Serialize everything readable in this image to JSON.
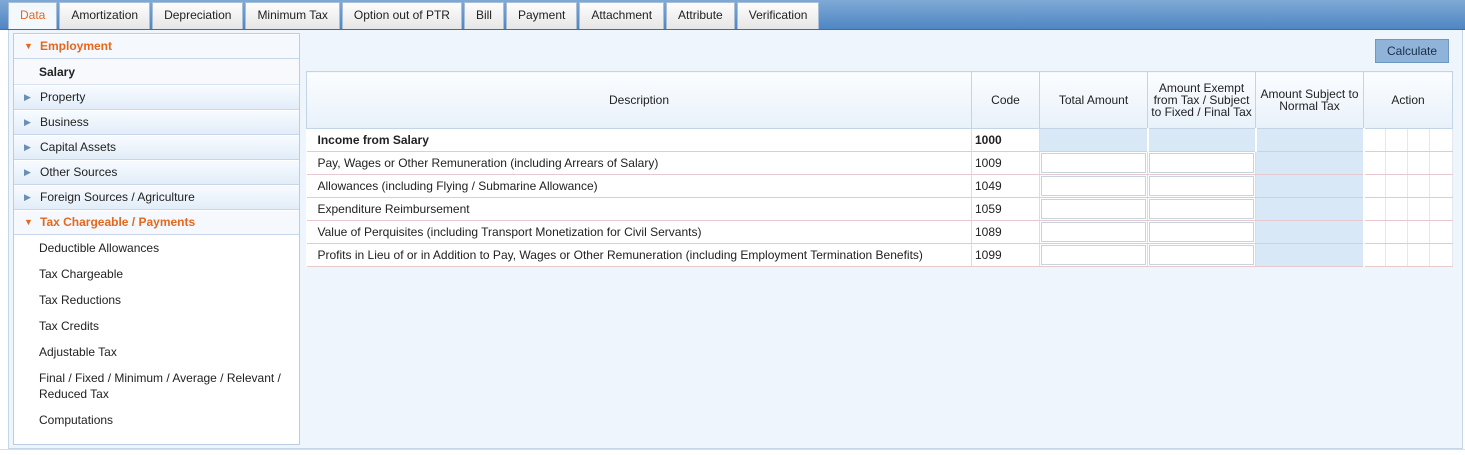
{
  "tabs": [
    "Data",
    "Amortization",
    "Depreciation",
    "Minimum Tax",
    "Option out of PTR",
    "Bill",
    "Payment",
    "Attachment",
    "Attribute",
    "Verification"
  ],
  "sidebar": {
    "employment": "Employment",
    "salary": "Salary",
    "property": "Property",
    "business": "Business",
    "capital_assets": "Capital Assets",
    "other_sources": "Other Sources",
    "foreign_sources": "Foreign Sources / Agriculture",
    "tax_chargeable": "Tax Chargeable / Payments",
    "sub_items": [
      "Deductible Allowances",
      "Tax Chargeable",
      "Tax Reductions",
      "Tax Credits",
      "Adjustable Tax",
      "Final / Fixed / Minimum / Average / Relevant / Reduced Tax",
      "Computations"
    ]
  },
  "calculate_label": "Calculate",
  "table": {
    "headers": {
      "description": "Description",
      "code": "Code",
      "total": "Total Amount",
      "exempt": "Amount Exempt from Tax / Subject to Fixed / Final Tax",
      "subject": "Amount Subject to Normal Tax",
      "action": "Action"
    },
    "rows": [
      {
        "desc": "Income from Salary",
        "code": "1000"
      },
      {
        "desc": "Pay, Wages or Other Remuneration (including Arrears of Salary)",
        "code": "1009"
      },
      {
        "desc": "Allowances (including Flying / Submarine Allowance)",
        "code": "1049"
      },
      {
        "desc": "Expenditure Reimbursement",
        "code": "1059"
      },
      {
        "desc": "Value of Perquisites (including Transport Monetization for Civil Servants)",
        "code": "1089"
      },
      {
        "desc": "Profits in Lieu of or in Addition to Pay, Wages or Other Remuneration (including Employment Termination Benefits)",
        "code": "1099"
      }
    ]
  }
}
